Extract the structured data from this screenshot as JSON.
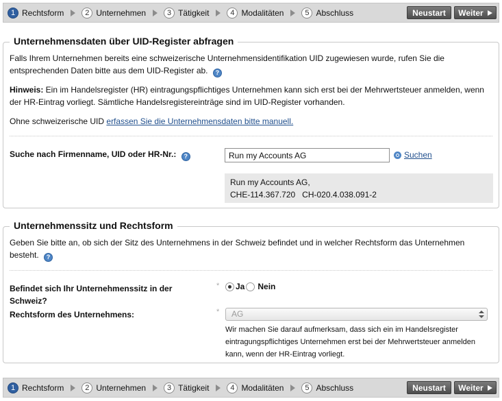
{
  "steps": [
    {
      "num": "1",
      "label": "Rechtsform",
      "active": true
    },
    {
      "num": "2",
      "label": "Unternehmen",
      "active": false
    },
    {
      "num": "3",
      "label": "Tätigkeit",
      "active": false
    },
    {
      "num": "4",
      "label": "Modalitäten",
      "active": false
    },
    {
      "num": "5",
      "label": "Abschluss",
      "active": false
    }
  ],
  "buttons": {
    "restart": "Neustart",
    "next": "Weiter"
  },
  "uid_section": {
    "title": "Unternehmensdaten über UID-Register abfragen",
    "intro": "Falls Ihrem Unternehmen bereits eine schweizerische Unternehmensidentifikation UID zugewiesen wurde, rufen Sie die entsprechenden Daten bitte aus dem UID-Register ab.",
    "hint_label": "Hinweis:",
    "hint_text": " Ein im Handelsregister (HR) eintragungspflichtiges Unternehmen kann sich erst bei der Mehrwertsteuer anmelden, wenn der HR-Eintrag vorliegt. Sämtliche Handelsregistereinträge sind im UID-Register vorhanden.",
    "manual_prefix": "Ohne schweizerische UID ",
    "manual_link": "erfassen Sie die Unternehmensdaten bitte manuell.",
    "search_label": "Suche nach Firmenname, UID oder HR-Nr.:",
    "search_value": "Run my Accounts AG",
    "search_button": "Suchen",
    "result_name": "Run my Accounts AG,",
    "result_ids": "CHE-114.367.720   CH-020.4.038.091-2"
  },
  "seat_section": {
    "title": "Unternehmenssitz und Rechtsform",
    "intro": "Geben Sie bitte an, ob sich der Sitz des Unternehmens in der Schweiz befindet und in welcher Rechtsform das Unternehmen besteht.",
    "seat_question": "Befindet sich Ihr Unternehmenssitz in der Schweiz?",
    "yes": "Ja",
    "no": "Nein",
    "seat_answer": "Ja",
    "legal_form_label": "Rechtsform des Unternehmens:",
    "legal_form_value": "AG",
    "legal_form_note": "Wir machen Sie darauf aufmerksam, dass sich ein im Handelsregister eintragungspflichtiges Unternehmen erst bei der Mehrwertsteuer anmelden kann, wenn der HR-Eintrag vorliegt.",
    "required_mark": "*"
  },
  "icons": {
    "help": "help-icon",
    "search": "search-icon",
    "step_arrow": "step-arrow-icon",
    "next_arrow": "play-arrow-icon"
  },
  "colors": {
    "step_active": "#2f5fa0",
    "button": "#5a5a5a",
    "link": "#1f4e8c",
    "help_icon": "#4f86c6"
  }
}
